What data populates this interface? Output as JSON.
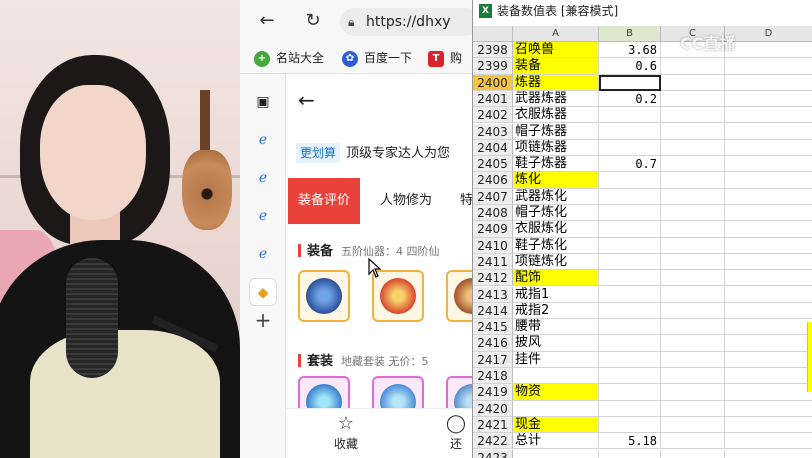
{
  "browser": {
    "url": "https://dhxy",
    "bookmarks": [
      "名站大全",
      "百度一下",
      "购"
    ],
    "page": {
      "promo_tag": "更划算",
      "promo_text": "顶级专家达人为您",
      "tabs": [
        "装备评价",
        "人物修为",
        "特"
      ],
      "equip_section": {
        "title": "装备",
        "sub": "五阶仙器：4  四阶仙"
      },
      "set_section": {
        "title": "套装",
        "sub": "地藏套装   无价：5"
      },
      "bottom": {
        "favorite": "收藏",
        "second": "还"
      }
    }
  },
  "sheet": {
    "title": "装备数值表  [兼容模式]",
    "columns": [
      "A",
      "B",
      "C",
      "D"
    ],
    "selected_row": "2400",
    "active_cell": "B2400",
    "rows": [
      {
        "n": "2398",
        "a": "召唤兽",
        "b": "3.68",
        "hl": true
      },
      {
        "n": "2399",
        "a": "装备",
        "b": "0.6",
        "hl": true
      },
      {
        "n": "2400",
        "a": "炼器",
        "b": "",
        "hl": true
      },
      {
        "n": "2401",
        "a": "武器炼器",
        "b": "0.2",
        "hl": false
      },
      {
        "n": "2402",
        "a": "衣服炼器",
        "b": "",
        "hl": false
      },
      {
        "n": "2403",
        "a": "帽子炼器",
        "b": "",
        "hl": false
      },
      {
        "n": "2404",
        "a": "项链炼器",
        "b": "",
        "hl": false
      },
      {
        "n": "2405",
        "a": "鞋子炼器",
        "b": "0.7",
        "hl": false
      },
      {
        "n": "2406",
        "a": "炼化",
        "b": "",
        "hl": true
      },
      {
        "n": "2407",
        "a": "武器炼化",
        "b": "",
        "hl": false
      },
      {
        "n": "2408",
        "a": "帽子炼化",
        "b": "",
        "hl": false
      },
      {
        "n": "2409",
        "a": "衣服炼化",
        "b": "",
        "hl": false
      },
      {
        "n": "2410",
        "a": "鞋子炼化",
        "b": "",
        "hl": false
      },
      {
        "n": "2411",
        "a": "项链炼化",
        "b": "",
        "hl": false
      },
      {
        "n": "2412",
        "a": "配饰",
        "b": "",
        "hl": true
      },
      {
        "n": "2413",
        "a": "戒指1",
        "b": "",
        "hl": false
      },
      {
        "n": "2414",
        "a": "戒指2",
        "b": "",
        "hl": false
      },
      {
        "n": "2415",
        "a": "腰带",
        "b": "",
        "hl": false
      },
      {
        "n": "2416",
        "a": "披风",
        "b": "",
        "hl": false
      },
      {
        "n": "2417",
        "a": "挂件",
        "b": "",
        "hl": false
      },
      {
        "n": "2418",
        "a": "",
        "b": "",
        "hl": false
      },
      {
        "n": "2419",
        "a": "物资",
        "b": "",
        "hl": true
      },
      {
        "n": "2420",
        "a": "",
        "b": "",
        "hl": false
      },
      {
        "n": "2421",
        "a": "现金",
        "b": "",
        "hl": true
      },
      {
        "n": "2422",
        "a": "总计",
        "b": "5.18",
        "hl": false
      },
      {
        "n": "2423",
        "a": "",
        "b": "",
        "hl": false
      }
    ]
  },
  "watermark": "CC直播",
  "colors": {
    "highlight": "#ffff00",
    "tab_active": "#e8423a",
    "excel_green": "#1f7a3e"
  }
}
